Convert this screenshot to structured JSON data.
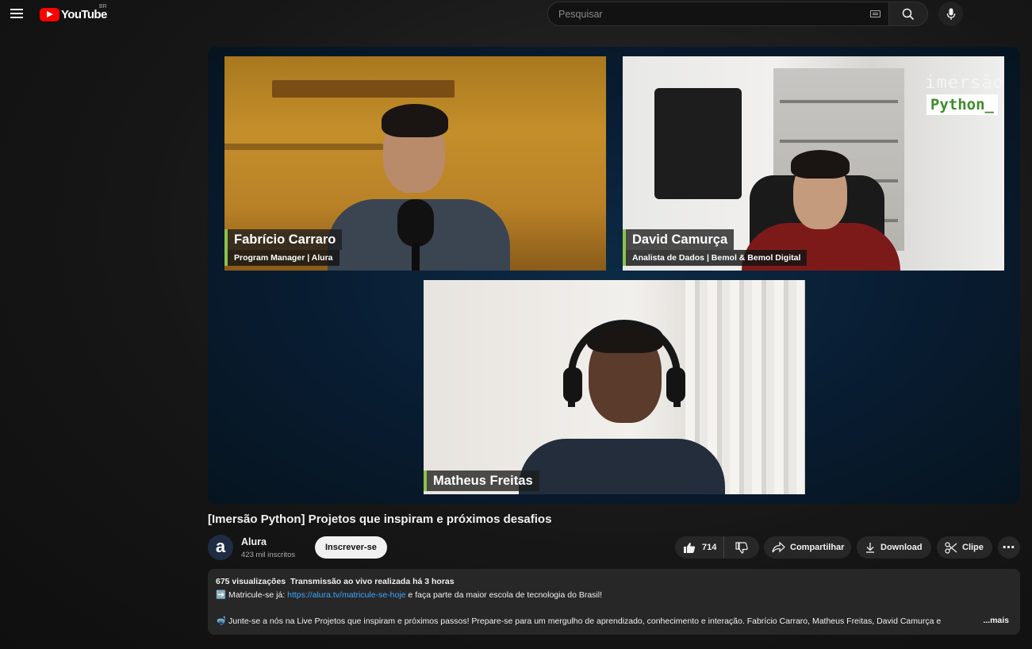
{
  "header": {
    "logo_text": "YouTube",
    "country": "BR",
    "search_placeholder": "Pesquisar"
  },
  "player": {
    "brand_top": "imersão",
    "brand_bottom": "Python_",
    "participants": [
      {
        "name": "Fabrício Carraro",
        "role": "Program Manager | Alura"
      },
      {
        "name": "David Camurça",
        "role": "Analista de Dados | Bemol & Bemol Digital"
      },
      {
        "name": "Matheus Freitas",
        "role": ""
      }
    ]
  },
  "video": {
    "title": "[Imersão Python] Projetos que inspiram e próximos desafios"
  },
  "channel": {
    "avatar_letter": "a",
    "name": "Alura",
    "subscribers": "423 mil inscritos",
    "subscribe_label": "Inscrever-se"
  },
  "actions": {
    "likes": "714",
    "share_label": "Compartilhar",
    "download_label": "Download",
    "clip_label": "Clipe",
    "more_label": "⋯"
  },
  "description": {
    "views": "675 visualizações",
    "streamed": "Transmissão ao vivo realizada há 3 horas",
    "line1_prefix": "➡️ Matricule-se já: ",
    "line1_link": "https://alura.tv/matricule-se-hoje",
    "line1_suffix": " e faça parte da maior escola de tecnologia do Brasil!",
    "line2": "🤿 Junte-se a nós na Live Projetos que inspiram e próximos passos! Prepare-se para um mergulho de aprendizado, conhecimento e interação. Fabrício Carraro, Matheus Freitas, David Camurça e",
    "more_label": "...mais"
  },
  "colors": {
    "accent_red": "#ff0000",
    "link_blue": "#3ea6ff",
    "lower_third_green": "#8bc34a"
  }
}
